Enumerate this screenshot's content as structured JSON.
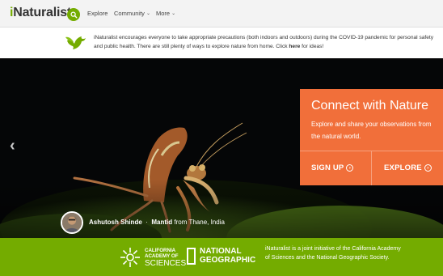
{
  "nav": {
    "logo_i": "i",
    "logo_rest": "Naturalist",
    "search_icon": "search-icon",
    "items": [
      {
        "label": "Explore",
        "has_chevron": false
      },
      {
        "label": "Community",
        "has_chevron": true
      },
      {
        "label": "More",
        "has_chevron": true
      }
    ],
    "chevron": "⌄"
  },
  "banner": {
    "icon": "bird-icon",
    "text_before": "iNaturalist encourages everyone to take appropriate precautions (both indoors and outdoors) during the COVID-19 pandemic for personal safety and public health. There are still plenty of ways to explore nature from home. Click ",
    "link": "here",
    "text_after": " for ideas!"
  },
  "hero": {
    "prev_icon": "chevron-left-icon",
    "prev_glyph": "‹",
    "connect": {
      "title": "Connect with Nature",
      "description": "Explore and share your observations from the natural world.",
      "signup_label": "SIGN UP",
      "explore_label": "EXPLORE",
      "arrow_glyph": "›"
    },
    "photo": {
      "observer": "Ashutosh Shinde",
      "separator": "·",
      "taxon": "Mantid",
      "from": "from",
      "place": "Thane, India"
    }
  },
  "partners": {
    "cas_line1": "CALIFORNIA",
    "cas_line2": "ACADEMY OF",
    "cas_line3": "SCIENCES",
    "ng_line1": "NATIONAL",
    "ng_line2": "GEOGRAPHIC",
    "text": "iNaturalist is a joint initiative of the California Academy of Sciences and the National Geographic Society."
  },
  "colors": {
    "brand_green": "#74ac00",
    "connect_orange": "#f16f3a",
    "hero_bg": "#050607"
  }
}
